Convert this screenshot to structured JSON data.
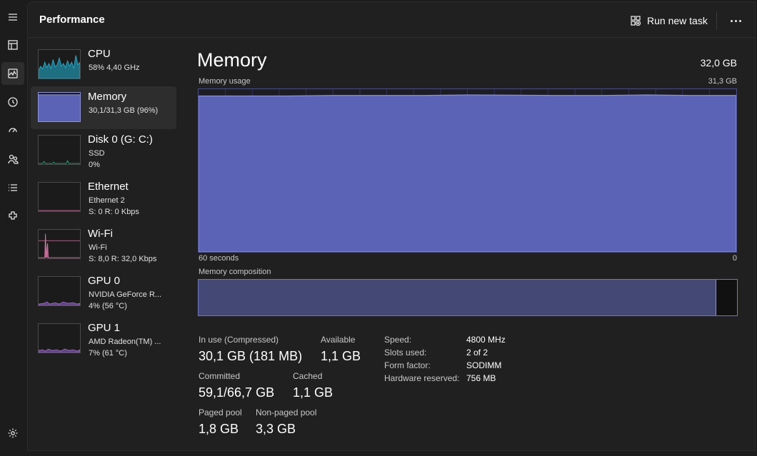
{
  "header": {
    "title": "Performance",
    "run_task_label": "Run new task"
  },
  "rail": {
    "icons": [
      "hamburger-menu-icon",
      "processes-icon",
      "performance-icon",
      "app-history-icon",
      "startup-apps-icon",
      "users-icon",
      "details-icon",
      "services-icon",
      "settings-icon"
    ]
  },
  "devices": [
    {
      "name": "CPU",
      "line1": "58% 4,40 GHz",
      "line2": ""
    },
    {
      "name": "Memory",
      "line1": "30,1/31,3 GB (96%)",
      "line2": ""
    },
    {
      "name": "Disk 0 (G: C:)",
      "line1": "SSD",
      "line2": "0%"
    },
    {
      "name": "Ethernet",
      "line1": "Ethernet 2",
      "line2": "S: 0 R: 0 Kbps"
    },
    {
      "name": "Wi-Fi",
      "line1": "Wi-Fi",
      "line2": "S: 8,0 R: 32,0 Kbps"
    },
    {
      "name": "GPU 0",
      "line1": "NVIDIA GeForce R...",
      "line2": "4% (56 °C)"
    },
    {
      "name": "GPU 1",
      "line1": "AMD Radeon(TM) ...",
      "line2": "7% (61 °C)"
    }
  ],
  "memory": {
    "title": "Memory",
    "total": "32,0 GB",
    "usage_label": "Memory usage",
    "usage_max": "31,3 GB",
    "axis_left": "60 seconds",
    "axis_right": "0",
    "composition_label": "Memory composition",
    "composition_in_use_fraction": 0.962
  },
  "stats": {
    "in_use_label": "In use (Compressed)",
    "in_use_value": "30,1 GB (181 MB)",
    "available_label": "Available",
    "available_value": "1,1 GB",
    "committed_label": "Committed",
    "committed_value": "59,1/66,7 GB",
    "cached_label": "Cached",
    "cached_value": "1,1 GB",
    "paged_label": "Paged pool",
    "paged_value": "1,8 GB",
    "nonpaged_label": "Non-paged pool",
    "nonpaged_value": "3,3 GB"
  },
  "specs": {
    "speed_label": "Speed:",
    "speed_value": "4800 MHz",
    "slots_label": "Slots used:",
    "slots_value": "2 of 2",
    "form_label": "Form factor:",
    "form_value": "SODIMM",
    "reserved_label": "Hardware reserved:",
    "reserved_value": "756 MB"
  },
  "chart_data": {
    "type": "area",
    "title": "Memory usage",
    "xlabel": "60 seconds",
    "ylim": [
      0,
      31.3
    ],
    "x": [
      60,
      50,
      45,
      40,
      35,
      30,
      20,
      15,
      10,
      5,
      0
    ],
    "values": [
      30.0,
      30.0,
      30.1,
      30.1,
      30.1,
      30.2,
      30.1,
      30.1,
      30.2,
      30.1,
      30.1
    ]
  },
  "colors": {
    "memory_accent": "#8b90d8",
    "memory_fill": "#5b63b6",
    "cpu_accent": "#2aa6c4",
    "disk_accent": "#27a57b",
    "network_accent": "#d874a8",
    "gpu_accent": "#a06cd0"
  }
}
